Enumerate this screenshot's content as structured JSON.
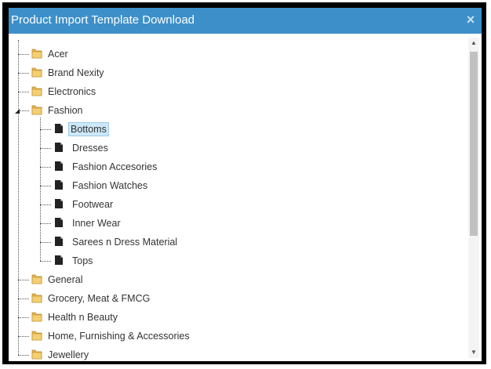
{
  "dialog": {
    "title": "Product Import Template Download",
    "close_glyph": "×"
  },
  "tree": {
    "categories": [
      {
        "label": "Acer",
        "icon": "folder-icon"
      },
      {
        "label": "Brand Nexity",
        "icon": "folder-icon"
      },
      {
        "label": "Electronics",
        "icon": "folder-icon"
      },
      {
        "label": "Fashion",
        "icon": "folder-icon",
        "expanded": true,
        "children": [
          {
            "label": "Bottoms",
            "selected": true
          },
          {
            "label": "Dresses"
          },
          {
            "label": "Fashion Accesories"
          },
          {
            "label": "Fashion Watches"
          },
          {
            "label": "Footwear"
          },
          {
            "label": "Inner Wear"
          },
          {
            "label": "Sarees n Dress Material"
          },
          {
            "label": "Tops"
          }
        ]
      },
      {
        "label": "General",
        "icon": "folder-icon"
      },
      {
        "label": "Grocery, Meat & FMCG",
        "icon": "folder-icon"
      },
      {
        "label": "Health n Beauty",
        "icon": "folder-icon"
      },
      {
        "label": "Home, Furnishing & Accessories",
        "icon": "folder-icon"
      },
      {
        "label": "Jewellery",
        "icon": "folder-icon"
      }
    ]
  },
  "colors": {
    "titlebar": "#3d8fc9",
    "selected_bg": "#cde8f8",
    "folder": "#e8b54a"
  }
}
